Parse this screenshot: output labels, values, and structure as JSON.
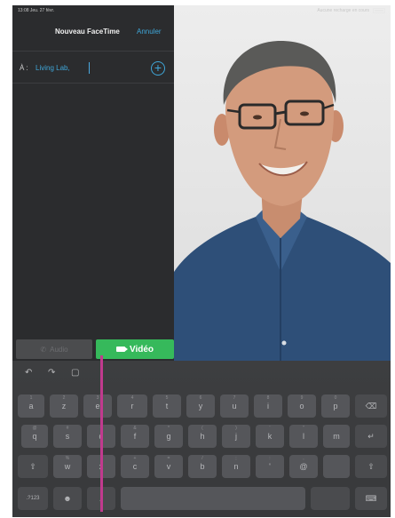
{
  "status_bar": {
    "time": "13:08  Jeu. 27 févr.",
    "right_text": "Aucune recharge en cours"
  },
  "facetime": {
    "title": "Nouveau FaceTime",
    "cancel": "Annuler",
    "to_label": "À :",
    "to_value": "Living Lab,",
    "add_icon": "plus-circle-icon",
    "audio_label": "Audio",
    "video_label": "Vidéo"
  },
  "keyboard": {
    "shortcuts": {
      "undo": "↶",
      "redo": "↷",
      "paste": "▢"
    },
    "row1": [
      "a",
      "z",
      "e",
      "r",
      "t",
      "y",
      "u",
      "i",
      "o",
      "p"
    ],
    "row1_sub": [
      "1",
      "2",
      "3",
      "4",
      "5",
      "6",
      "7",
      "8",
      "9",
      "0"
    ],
    "row2": [
      "q",
      "s",
      "d",
      "f",
      "g",
      "h",
      "j",
      "k",
      "l",
      "m"
    ],
    "row2_sub": [
      "@",
      "#",
      "€",
      "&",
      "*",
      "(",
      ")",
      "'",
      "\"",
      ""
    ],
    "row3": [
      "w",
      "x",
      "c",
      "v",
      "b",
      "n",
      "'",
      "@"
    ],
    "row3_sub": [
      "%",
      "-",
      "+",
      "=",
      "/",
      ";",
      ":",
      ","
    ],
    "delete_icon": "backspace-icon",
    "return_icon": "return-icon",
    "shift_icon": "shift-icon",
    "numbers_label": ".?123",
    "emoji_icon": "emoji-icon",
    "mic_icon": "microphone-icon",
    "hide_icon": "keyboard-hide-icon"
  },
  "colors": {
    "accent": "#3fa6d8",
    "video_green": "#36b95b",
    "marker": "#c13a8e"
  }
}
